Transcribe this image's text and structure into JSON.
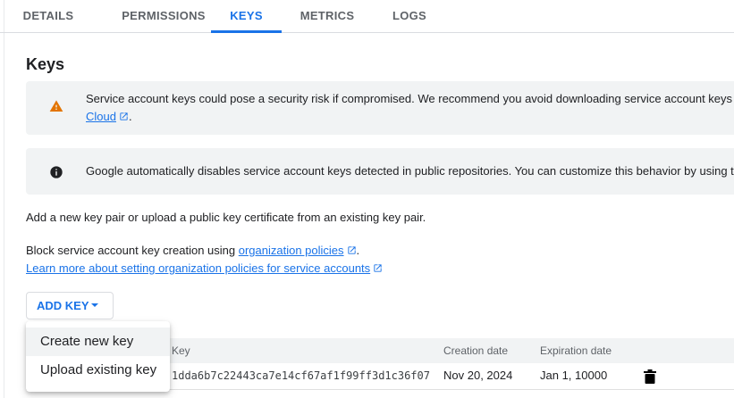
{
  "tabs": [
    {
      "label": "DETAILS"
    },
    {
      "label": "PERMISSIONS"
    },
    {
      "label": "KEYS",
      "active": true
    },
    {
      "label": "METRICS"
    },
    {
      "label": "LOGS"
    }
  ],
  "section_title": "Keys",
  "warning_banner": {
    "icon": "warning-icon",
    "line1": "Service account keys could pose a security risk if compromised. We recommend you avoid downloading service account keys",
    "link": "Cloud",
    "link_suffix": "."
  },
  "info_banner": {
    "icon": "info-icon",
    "text": "Google automatically disables service account keys detected in public repositories. You can customize this behavior by using t"
  },
  "add_key_description": "Add a new key pair or upload a public key certificate from an existing key pair.",
  "block_creation": {
    "prefix": "Block service account key creation using ",
    "link": "organization policies",
    "suffix": "."
  },
  "learn_more_link": "Learn more about setting organization policies for service accounts",
  "add_key_button": "ADD KEY",
  "add_key_menu": [
    "Create new key",
    "Upload existing key"
  ],
  "table": {
    "columns": [
      "Key",
      "Creation date",
      "Expiration date"
    ],
    "rows": [
      {
        "key": "1dda6b7c22443ca7e14cf67af1f99ff3d1c36f07",
        "created": "Nov 20, 2024",
        "expires": "Jan 1, 10000"
      }
    ]
  },
  "colors": {
    "accent": "#1a73e8",
    "warning": "#e37400",
    "banner_bg": "#f1f3f4"
  }
}
